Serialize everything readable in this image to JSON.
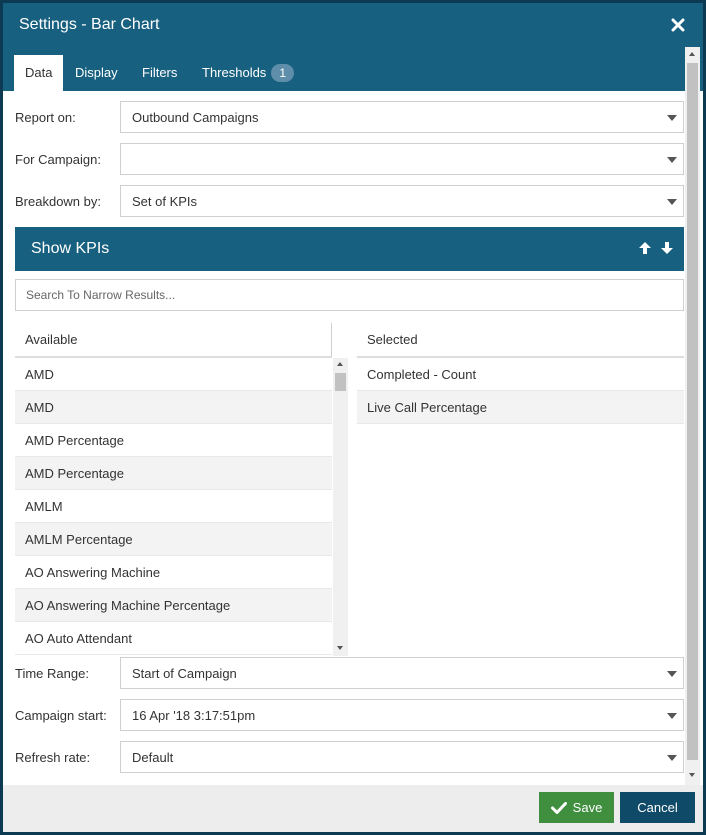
{
  "window": {
    "title": "Settings - Bar Chart"
  },
  "tabs": [
    {
      "label": "Data",
      "active": true
    },
    {
      "label": "Display"
    },
    {
      "label": "Filters"
    },
    {
      "label": "Thresholds",
      "badge": "1"
    }
  ],
  "fields": {
    "report_on": {
      "label": "Report on:",
      "value": "Outbound Campaigns"
    },
    "for_campaign": {
      "label": "For Campaign:",
      "value": ""
    },
    "breakdown_by": {
      "label": "Breakdown by:",
      "value": "Set of KPIs"
    },
    "time_range": {
      "label": "Time Range:",
      "value": "Start of Campaign"
    },
    "campaign_start": {
      "label": "Campaign start:",
      "value": "16 Apr '18 3:17:51pm"
    },
    "refresh_rate": {
      "label": "Refresh rate:",
      "value": "Default"
    }
  },
  "kpis": {
    "title": "Show KPIs",
    "search_placeholder": "Search To Narrow Results...",
    "available_header": "Available",
    "selected_header": "Selected",
    "available": [
      "AMD",
      "AMD",
      "AMD Percentage",
      "AMD Percentage",
      "AMLM",
      "AMLM Percentage",
      "AO Answering Machine",
      "AO Answering Machine Percentage",
      "AO Auto Attendant"
    ],
    "selected": [
      "Completed - Count",
      "Live Call Percentage"
    ]
  },
  "footer": {
    "save_label": "Save",
    "cancel_label": "Cancel"
  },
  "icons": {
    "close": "close-icon",
    "up": "arrow-up-icon",
    "down": "arrow-down-icon",
    "check": "check-icon"
  },
  "colors": {
    "header": "#186080",
    "save": "#3f8f3f",
    "cancel": "#0f4a68"
  }
}
